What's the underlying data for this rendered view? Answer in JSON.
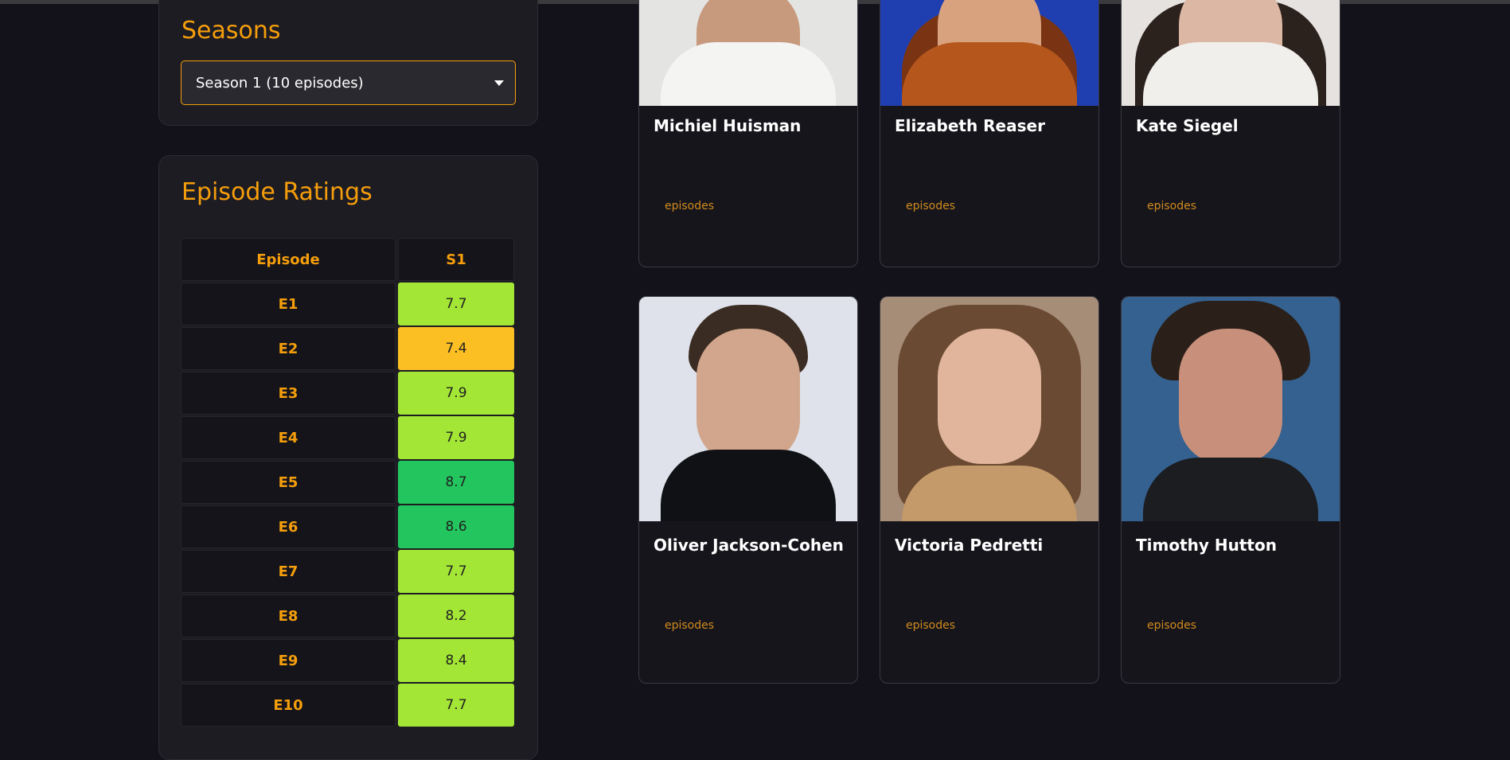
{
  "seasons": {
    "title": "Seasons",
    "selected": "Season 1 (10 episodes)"
  },
  "ratings": {
    "title": "Episode Ratings",
    "header": {
      "episode": "Episode",
      "season": "S1"
    },
    "rows": [
      {
        "episode": "E1",
        "rating": "7.7",
        "color": "#a3e635"
      },
      {
        "episode": "E2",
        "rating": "7.4",
        "color": "#fbbf24"
      },
      {
        "episode": "E3",
        "rating": "7.9",
        "color": "#a3e635"
      },
      {
        "episode": "E4",
        "rating": "7.9",
        "color": "#a3e635"
      },
      {
        "episode": "E5",
        "rating": "8.7",
        "color": "#22c55e"
      },
      {
        "episode": "E6",
        "rating": "8.6",
        "color": "#22c55e"
      },
      {
        "episode": "E7",
        "rating": "7.7",
        "color": "#a3e635"
      },
      {
        "episode": "E8",
        "rating": "8.2",
        "color": "#a3e635"
      },
      {
        "episode": "E9",
        "rating": "8.4",
        "color": "#a3e635"
      },
      {
        "episode": "E10",
        "rating": "7.7",
        "color": "#a3e635"
      }
    ]
  },
  "cast": [
    {
      "name": "Michiel Huisman",
      "tag": "episodes"
    },
    {
      "name": "Elizabeth Reaser",
      "tag": "episodes"
    },
    {
      "name": "Kate Siegel",
      "tag": "episodes"
    },
    {
      "name": "Oliver Jackson-Cohen",
      "tag": "episodes"
    },
    {
      "name": "Victoria Pedretti",
      "tag": "episodes"
    },
    {
      "name": "Timothy Hutton",
      "tag": "episodes"
    }
  ],
  "colors": {
    "accent": "#f59e0b",
    "background": "#13121a",
    "panel": "#1d1c23"
  }
}
